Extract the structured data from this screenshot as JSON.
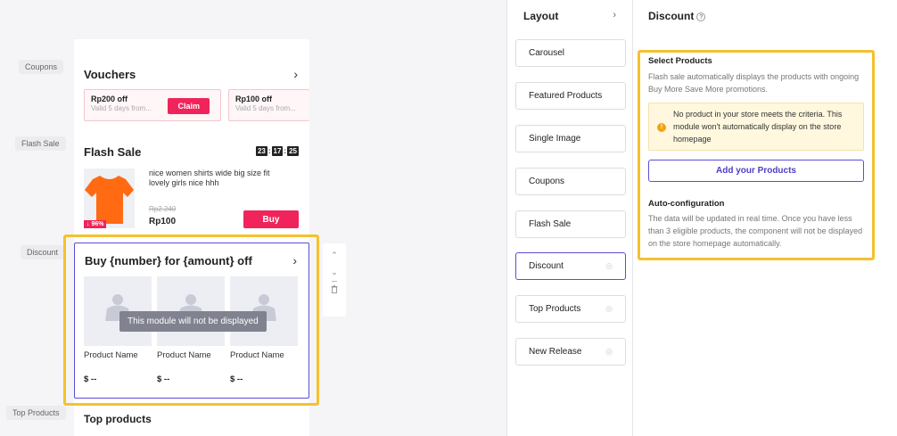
{
  "canvas": {
    "tags": {
      "coupons": "Coupons",
      "flash_sale": "Flash Sale",
      "discount": "Discount",
      "top_products": "Top Products"
    },
    "vouchers": {
      "title": "Vouchers",
      "items": [
        {
          "title": "Rp200 off",
          "subtitle": "Valid 5 days from...",
          "claim": "Claim"
        },
        {
          "title": "Rp100 off",
          "subtitle": "Valid 5 days from..."
        }
      ]
    },
    "flash_sale": {
      "title": "Flash Sale",
      "timer": [
        "23",
        "17",
        "25"
      ],
      "product_name": "nice women shirts wide big size fit lovely girls nice hhh",
      "badge": "↓ 96%",
      "old_price": "Rp2.240",
      "price": "Rp100",
      "buy": "Buy",
      "image_color": "#ff6a13"
    },
    "discount_module": {
      "title": "Buy {number} for {amount} off",
      "notice": "This module will not be displayed",
      "products": [
        {
          "name": "Product Name",
          "price": "$ --"
        },
        {
          "name": "Product Name",
          "price": "$ --"
        },
        {
          "name": "Product Name",
          "price": "$ --"
        }
      ]
    },
    "top_products": {
      "title": "Top products"
    }
  },
  "layout": {
    "title": "Layout",
    "items": [
      {
        "label": "Carousel",
        "hidden": false
      },
      {
        "label": "Featured Products",
        "hidden": false
      },
      {
        "label": "Single Image",
        "hidden": false
      },
      {
        "label": "Coupons",
        "hidden": false
      },
      {
        "label": "Flash Sale",
        "hidden": false
      },
      {
        "label": "Discount",
        "hidden": true,
        "active": true
      },
      {
        "label": "Top Products",
        "hidden": true
      },
      {
        "label": "New Release",
        "hidden": true
      }
    ]
  },
  "panel": {
    "title": "Discount",
    "select_heading": "Select Products",
    "select_desc": "Flash sale automatically displays the products with ongoing Buy More Save More promotions.",
    "warning": "No product in your store meets the criteria. This module won't automatically display on the store homepage",
    "add_button": "Add your Products",
    "auto_heading": "Auto-configuration",
    "auto_desc": "The data will be updated in real time. Once you have less than 3 eligible products, the component will not be displayed on the store homepage automatically."
  },
  "colors": {
    "accent": "#5c4dd6",
    "highlight": "#f5c12e",
    "buy": "#f0245a"
  }
}
